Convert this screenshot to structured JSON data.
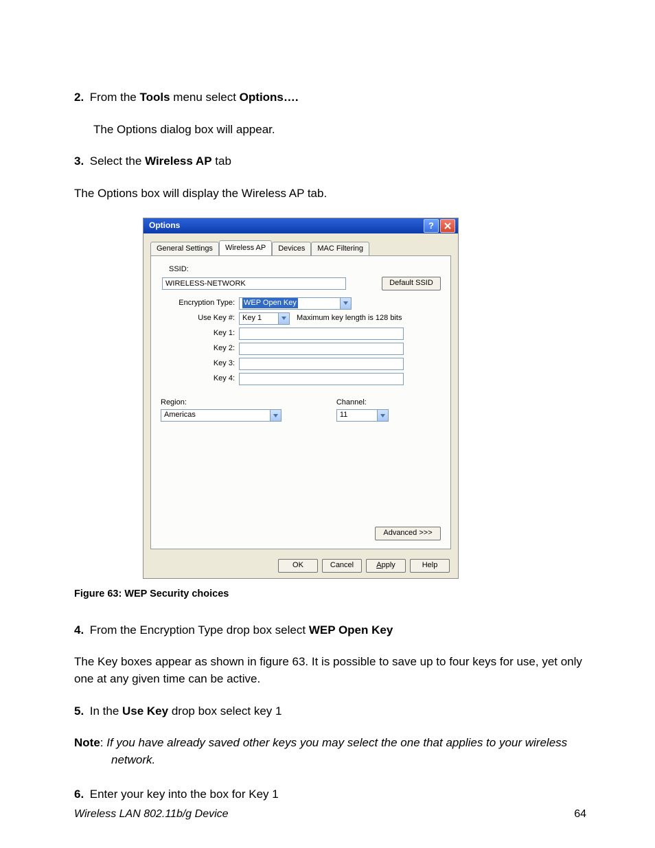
{
  "step2": {
    "num": "2.",
    "prefix": "From the ",
    "b1": "Tools",
    "mid": " menu select ",
    "b2": "Options…."
  },
  "para1": "The Options dialog box will appear.",
  "step3": {
    "num": "3.",
    "prefix": "Select the ",
    "b1": "Wireless AP",
    "suffix": " tab"
  },
  "para2": "The Options box will display the Wireless AP tab.",
  "shot": {
    "title": "Options",
    "help_glyph": "?",
    "tabs": {
      "t1": "General Settings",
      "t2": "Wireless AP",
      "t3": "Devices",
      "t4": "MAC Filtering"
    },
    "ssid_label": "SSID:",
    "ssid_value": "WIRELESS-NETWORK",
    "default_ssid_btn": "Default SSID",
    "enc_label": "Encryption Type:",
    "enc_value": "WEP Open Key",
    "usekey_label": "Use Key #:",
    "usekey_value": "Key 1",
    "maxlen": "Maximum key length is 128 bits",
    "keys": {
      "k1": "Key 1:",
      "k2": "Key 2:",
      "k3": "Key 3:",
      "k4": "Key 4:"
    },
    "region_label": "Region:",
    "region_value": "Americas",
    "channel_label": "Channel:",
    "channel_value": "11",
    "advanced_btn": "Advanced >>>",
    "ok": "OK",
    "cancel": "Cancel",
    "apply": "pply",
    "apply_u": "A",
    "help": "Help"
  },
  "fig_caption": "Figure 63: WEP Security choices",
  "step4": {
    "num": "4.",
    "prefix": "From the Encryption Type drop box select ",
    "b1": "WEP Open Key"
  },
  "para3": "The Key boxes appear as shown in figure 63.  It is possible to save up to four keys for use, yet only one at any given time can be active.",
  "step5": {
    "num": "5.",
    "prefix": "In the ",
    "b1": "Use Key",
    "suffix": " drop box select key 1"
  },
  "note": {
    "label": "Note",
    "colon": ":  ",
    "body": "If you have already saved other keys you may select the one that applies to your wireless network."
  },
  "step6": {
    "num": "6.",
    "text": "Enter your key into the box for Key 1"
  },
  "footer_left": "Wireless LAN 802.11b/g Device",
  "footer_right": "64"
}
